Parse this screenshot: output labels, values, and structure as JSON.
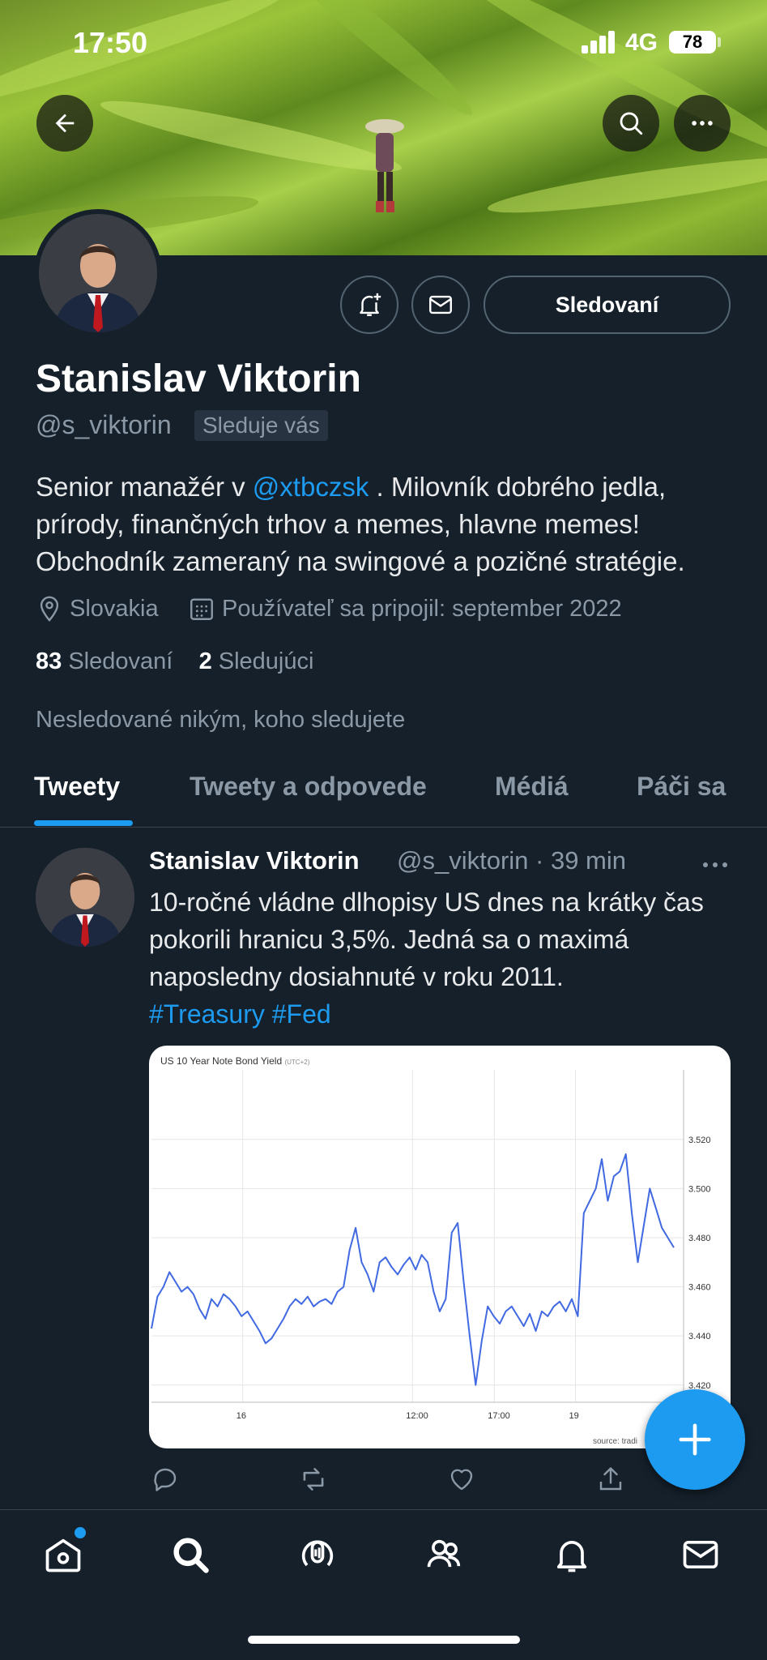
{
  "status_bar": {
    "time": "17:50",
    "network": "4G",
    "battery": "78"
  },
  "profile": {
    "name": "Stanislav Viktorin",
    "handle": "@s_viktorin",
    "follows_you_badge": "Sleduje vás",
    "bio_part1": "Senior manažér v ",
    "bio_link": "@xtbczsk",
    "bio_part2": " . Milovník dobrého jedla, prírody, finančných trhov a memes, hlavne memes! Obchodník zameraný na swingové a pozičné stratégie.",
    "location": "Slovakia",
    "joined": "Používateľ sa pripojil: september 2022",
    "following_count": "83",
    "following_label": "Sledovaní",
    "followers_count": "2",
    "followers_label": "Sledujúci",
    "not_followed_note": "Nesledované nikým, koho sledujete",
    "follow_button": "Sledovaní"
  },
  "tabs": [
    {
      "label": "Tweety",
      "active": true
    },
    {
      "label": "Tweety a odpovede",
      "active": false
    },
    {
      "label": "Médiá",
      "active": false
    },
    {
      "label": "Páči sa",
      "active": false
    }
  ],
  "tweet": {
    "author": "Stanislav Viktorin",
    "handle_time": "@s_viktorin · 39 min",
    "text": "10-ročné vládne dlhopisy US dnes na krátky čas pokorili hranicu 3,5%. Jedná sa o maximá naposledny dosiahnuté v roku 2011.",
    "hashtag1": "#Treasury",
    "hashtag2": "#Fed",
    "chart_title": "US 10 Year Note Bond Yield",
    "chart_tz": "(UTC+2)",
    "chart_source": "source: tradi"
  },
  "colors": {
    "accent": "#1d9bf0",
    "background": "#15202b",
    "muted": "#8b98a5",
    "chart_line": "#4169e1"
  },
  "chart_data": {
    "type": "line",
    "title": "US 10 Year Note Bond Yield",
    "subtitle": "(UTC+2)",
    "xlabel": "",
    "ylabel": "",
    "x_tick_labels": [
      "16",
      "12:00",
      "17:00",
      "19"
    ],
    "y_tick_labels": [
      "3.520",
      "3.500",
      "3.480",
      "3.460",
      "3.440",
      "3.420"
    ],
    "ylim": [
      3.413,
      3.545
    ],
    "grid": true,
    "series": [
      {
        "name": "",
        "values": [
          3.443,
          3.456,
          3.46,
          3.466,
          3.462,
          3.458,
          3.46,
          3.457,
          3.451,
          3.447,
          3.455,
          3.452,
          3.457,
          3.455,
          3.452,
          3.448,
          3.45,
          3.446,
          3.442,
          3.437,
          3.439,
          3.443,
          3.447,
          3.452,
          3.455,
          3.453,
          3.456,
          3.452,
          3.454,
          3.455,
          3.453,
          3.458,
          3.46,
          3.475,
          3.484,
          3.47,
          3.465,
          3.458,
          3.47,
          3.472,
          3.468,
          3.465,
          3.469,
          3.472,
          3.467,
          3.473,
          3.47,
          3.458,
          3.45,
          3.455,
          3.482,
          3.486,
          3.462,
          3.44,
          3.42,
          3.438,
          3.452,
          3.448,
          3.445,
          3.45,
          3.452,
          3.448,
          3.444,
          3.449,
          3.442,
          3.45,
          3.448,
          3.452,
          3.454,
          3.45,
          3.455,
          3.448,
          3.49,
          3.495,
          3.5,
          3.512,
          3.495,
          3.505,
          3.507,
          3.514,
          3.49,
          3.47,
          3.485,
          3.5,
          3.492,
          3.484,
          3.48,
          3.476
        ]
      }
    ]
  },
  "nav": [
    "home-icon",
    "search-icon",
    "spaces-icon",
    "communities-icon",
    "notifications-icon",
    "messages-icon"
  ]
}
